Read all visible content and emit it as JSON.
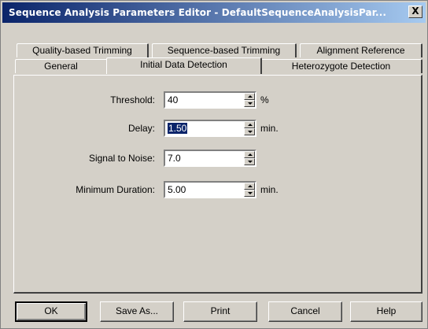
{
  "window": {
    "title": "Sequence Analysis Parameters Editor - DefaultSequenceAnalysisPar...",
    "close_glyph": "X"
  },
  "tabs": {
    "row_back": [
      {
        "label": "Quality-based Trimming"
      },
      {
        "label": "Sequence-based Trimming"
      },
      {
        "label": "Alignment Reference"
      }
    ],
    "row_front": [
      {
        "label": "General"
      },
      {
        "label": "Initial Data Detection",
        "active": true
      },
      {
        "label": "Heterozygote Detection"
      }
    ]
  },
  "fields": [
    {
      "label": "Threshold:",
      "value": "40",
      "unit": "%"
    },
    {
      "label": "Delay:",
      "value": "1.50",
      "unit": "min.",
      "selected": true
    },
    {
      "label": "Signal to Noise:",
      "value": "7.0",
      "unit": ""
    },
    {
      "label": "Minimum Duration:",
      "value": "5.00",
      "unit": "min."
    }
  ],
  "buttons": {
    "ok": "OK",
    "save_as": "Save As...",
    "print": "Print",
    "cancel": "Cancel",
    "help": "Help"
  }
}
